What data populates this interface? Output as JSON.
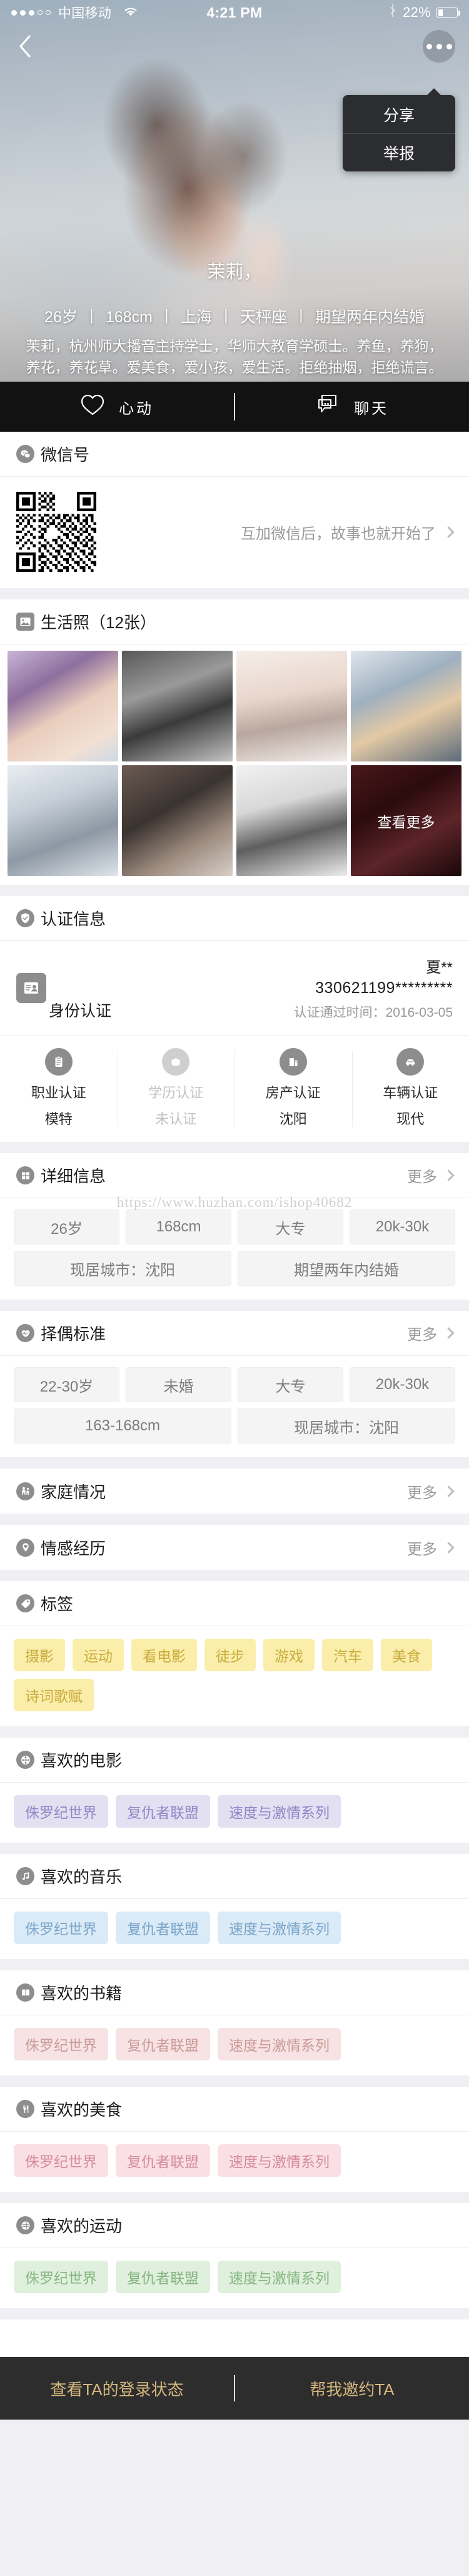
{
  "status_bar": {
    "carrier": "中国移动",
    "time": "4:21 PM",
    "battery_pct": "22%",
    "signal_icon": "signal-dots-icon",
    "wifi_icon": "wifi-icon",
    "bluetooth_icon": "bluetooth-icon",
    "battery_icon": "battery-icon"
  },
  "nav": {
    "back_icon": "back-chevron-icon",
    "more_icon": "more-dots-icon",
    "menu": [
      {
        "label": "分享",
        "name": "menu-item-share"
      },
      {
        "label": "举报",
        "name": "menu-item-report"
      }
    ]
  },
  "profile": {
    "name": "茉莉，",
    "meta": [
      "26岁",
      "168cm",
      "上海",
      "天枰座",
      "期望两年内结婚"
    ],
    "description": "茉莉，杭州师大播音主持学士，华师大教育学硕士。养鱼，养狗，养花，养花草。爱美食，爱小孩，爱生活。拒绝抽烟，拒绝谎言。"
  },
  "action_bar": {
    "like_label": "心动",
    "like_icon": "heart-icon",
    "chat_label": "聊天",
    "chat_icon": "chat-bubble-icon"
  },
  "wechat": {
    "title": "微信号",
    "icon": "wechat-icon",
    "qr_icon": "qr-code-icon",
    "note": "互加微信后，故事也就开始了",
    "chevron": "chevron-right-icon"
  },
  "photos": {
    "title": "生活照（12张）",
    "icon": "image-icon",
    "count": 12,
    "more_label": "查看更多"
  },
  "verification": {
    "title": "认证信息",
    "icon": "shield-check-icon",
    "id_row": {
      "icon": "id-card-icon",
      "label": "身份认证",
      "name": "夏**",
      "number": "330621199*********",
      "time": "认证通过时间：2016-03-05"
    },
    "items": [
      {
        "label": "职业认证",
        "value": "模特",
        "icon": "clipboard-icon",
        "verified": true
      },
      {
        "label": "学历认证",
        "value": "未认证",
        "icon": "graduation-cap-icon",
        "verified": false
      },
      {
        "label": "房产认证",
        "value": "沈阳",
        "icon": "house-icon",
        "verified": true
      },
      {
        "label": "车辆认证",
        "value": "现代",
        "icon": "car-icon",
        "verified": true
      }
    ]
  },
  "watermark": "https://www.huzhan.com/ishop40682",
  "detail": {
    "title": "详细信息",
    "icon": "grid-icon",
    "more_label": "更多",
    "row1": [
      "26岁",
      "168cm",
      "大专",
      "20k-30k"
    ],
    "row2": [
      "现居城市：沈阳",
      "期望两年内结婚"
    ]
  },
  "criteria": {
    "title": "择偶标准",
    "icon": "heartbeat-icon",
    "more_label": "更多",
    "row1": [
      "22-30岁",
      "未婚",
      "大专",
      "20k-30k"
    ],
    "row2": [
      "163-168cm",
      "现居城市：沈阳"
    ]
  },
  "family": {
    "title": "家庭情况",
    "icon": "family-icon",
    "more_label": "更多"
  },
  "emotion": {
    "title": "情感经历",
    "icon": "heart-pin-icon",
    "more_label": "更多"
  },
  "tags": {
    "title": "标签",
    "icon": "tag-icon",
    "items": [
      "摄影",
      "运动",
      "看电影",
      "徒步",
      "游戏",
      "汽车",
      "美食",
      "诗词歌赋"
    ]
  },
  "favorites": [
    {
      "title": "喜欢的电影",
      "icon": "film-reel-icon",
      "color": "purple",
      "items": [
        "侏罗纪世界",
        "复仇者联盟",
        "速度与激情系列"
      ]
    },
    {
      "title": "喜欢的音乐",
      "icon": "music-note-icon",
      "color": "blue",
      "items": [
        "侏罗纪世界",
        "复仇者联盟",
        "速度与激情系列"
      ]
    },
    {
      "title": "喜欢的书籍",
      "icon": "book-icon",
      "color": "pink",
      "items": [
        "侏罗纪世界",
        "复仇者联盟",
        "速度与激情系列"
      ]
    },
    {
      "title": "喜欢的美食",
      "icon": "food-icon",
      "color": "rose",
      "items": [
        "侏罗纪世界",
        "复仇者联盟",
        "速度与激情系列"
      ]
    },
    {
      "title": "喜欢的运动",
      "icon": "sport-icon",
      "color": "green",
      "items": [
        "侏罗纪世界",
        "复仇者联盟",
        "速度与激情系列"
      ]
    }
  ],
  "bottom_bar": {
    "left_label": "查看TA的登录状态",
    "right_label": "帮我邀约TA"
  }
}
